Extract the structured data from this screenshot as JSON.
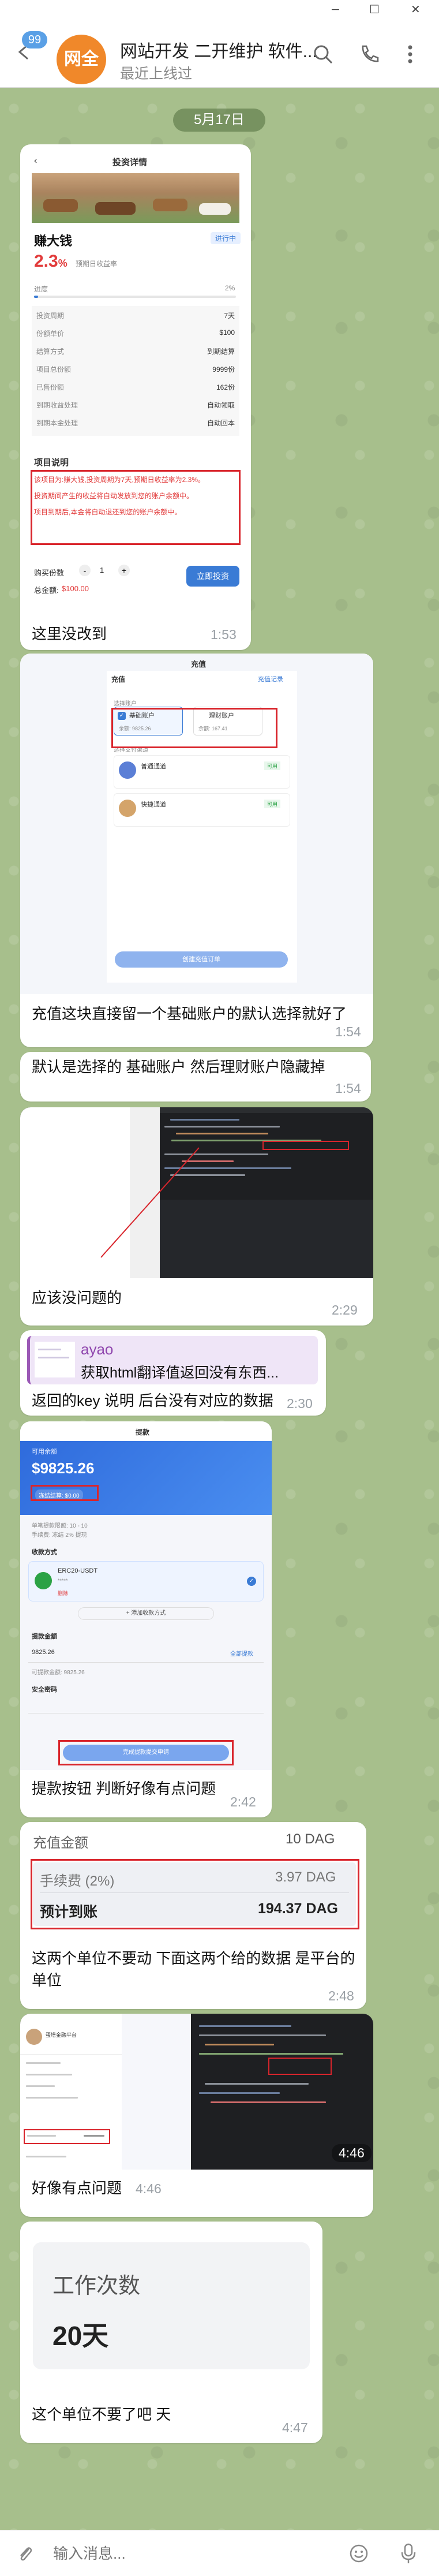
{
  "window": {
    "minimize": "─",
    "maximize": "☐",
    "close": "✕"
  },
  "header": {
    "back_count": "99",
    "avatar_text": "网全",
    "title": "网站开发 二开维护 软件...",
    "status": "最近上线过"
  },
  "date_chip": "5月17日",
  "msg1": {
    "app_title": "投资详情",
    "badge": "进行中",
    "product_name": "赚大钱",
    "rate": "2.3",
    "rate_pct": "%",
    "rate_label": "预期日收益率",
    "progress_label": "进度",
    "progress_value": "2%",
    "progress": 0.02,
    "rows": [
      {
        "k": "投资周期",
        "v": "7天"
      },
      {
        "k": "份额单价",
        "v": "$100"
      },
      {
        "k": "结算方式",
        "v": "到期结算"
      },
      {
        "k": "项目总份额",
        "v": "9999份"
      },
      {
        "k": "已售份额",
        "v": "162份"
      },
      {
        "k": "到期收益处理",
        "v": "自动领取"
      },
      {
        "k": "到期本金处理",
        "v": "自动回本"
      }
    ],
    "desc_title": "项目说明",
    "desc_lines": [
      "该项目为:赚大钱,投资周期为7天,预期日收益率为2.3%。",
      "投资期间产生的收益将自动发放到您的账户余额中。",
      "项目到期后,本金将自动退还到您的账户余额中。"
    ],
    "qty_label": "购买份数",
    "qty": "1",
    "total_label": "总金额:",
    "total": "$100.00",
    "buy_button": "立即投资",
    "text": "这里没改到",
    "time": "1:53"
  },
  "msg2": {
    "app_title": "充值",
    "tab": "充值",
    "record": "充值记录",
    "acct_label": "选择账户",
    "acct1": "基础账户",
    "acct1_bal": "余额: 9825.26",
    "acct2": "理财账户",
    "acct2_bal": "余额: 167.41",
    "method_label": "选择支付渠道",
    "ch1": "普通通道",
    "ch1_tag": "可用",
    "ch2": "快捷通道",
    "ch2_tag": "可用",
    "submit": "创建充值订单",
    "text": "充值这块直接留一个基础账户的默认选择就好了",
    "time": "1:54"
  },
  "msg3": {
    "text": "默认是选择的 基础账户 然后理财账户隐藏掉",
    "time": "1:54"
  },
  "msg4": {
    "text": "应该没问题的",
    "time": "2:29"
  },
  "msg5": {
    "reply_name": "ayao",
    "reply_text": "获取html翻译值返回没有东西...",
    "text": "返回的key 说明 后台没有对应的数据",
    "time": "2:30"
  },
  "msg6": {
    "app_title": "提款",
    "bal_label": "可用余额",
    "balance": "$9825.26",
    "pill": "冻结结算: $0.00",
    "info1": "单笔提款限额: 10 - 10",
    "info2": "手续费: 冻结 2% 提现",
    "method_label": "收款方式",
    "wallet": "ERC20-USDT",
    "wallet_addr": "*****",
    "wallet_del": "删除",
    "add_method": "+ 添加收款方式",
    "amount_label": "提款金额",
    "amount": "9825.26",
    "all": "全部提款",
    "avail": "可提款金额: 9825.26",
    "pwd_label": "安全密码",
    "submit": "完成提款提交申请",
    "text": "提款按钮 判断好像有点问题",
    "time": "2:42"
  },
  "msg7": {
    "recharge_label": "充值金额",
    "recharge_value": "10 DAG",
    "fee_label": "手续费 (2%)",
    "fee_value": "3.97 DAG",
    "net_label": "预计到账",
    "net_value": "194.37 DAG",
    "text_line1": "这两个单位不要动 下面这两个给的数据 是平台的",
    "text_line2": "单位",
    "time": "2:48"
  },
  "msg8": {
    "name": "蛋塔金融平台",
    "time_overlay": "4:46",
    "text": "好像有点问题",
    "time": "4:46"
  },
  "msg9": {
    "card_label": "工作次数",
    "card_value": "20天",
    "text": "这个单位不要了吧 天",
    "time": "4:47"
  },
  "composer": {
    "placeholder": "输入消息..."
  }
}
